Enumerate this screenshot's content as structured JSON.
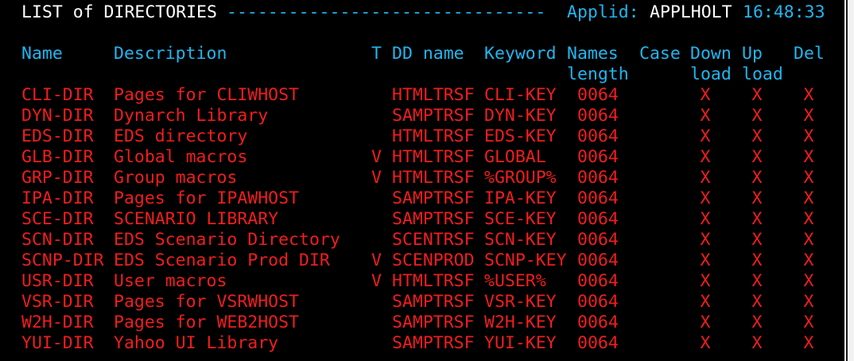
{
  "header": {
    "title": "LIST of DIRECTORIES",
    "dashes": "-------------------------------",
    "applid_label": "Applid:",
    "applid_value": "APPLHOLT",
    "time": "16:48:33"
  },
  "columns": {
    "name": "Name",
    "description": "Description",
    "type": "T",
    "dd_name": "DD name",
    "keyword": "Keyword",
    "names_length_1": "Names",
    "names_length_2": "length",
    "case": "Case",
    "download_1": "Down",
    "download_2": "load",
    "upload_1": "Up",
    "upload_2": "load",
    "del": "Del"
  },
  "rows": [
    {
      "name": "CLI-DIR",
      "description": "Pages for CLIWHOST",
      "type": "",
      "dd": "HTMLTRSF",
      "keyword": "CLI-KEY",
      "length": "0064",
      "case": "",
      "down": "X",
      "up": "X",
      "del": "X"
    },
    {
      "name": "DYN-DIR",
      "description": "Dynarch Library",
      "type": "",
      "dd": "SAMPTRSF",
      "keyword": "DYN-KEY",
      "length": "0064",
      "case": "",
      "down": "X",
      "up": "X",
      "del": "X"
    },
    {
      "name": "EDS-DIR",
      "description": "EDS directory",
      "type": "",
      "dd": "HTMLTRSF",
      "keyword": "EDS-KEY",
      "length": "0064",
      "case": "",
      "down": "X",
      "up": "X",
      "del": "X"
    },
    {
      "name": "GLB-DIR",
      "description": "Global macros",
      "type": "V",
      "dd": "HTMLTRSF",
      "keyword": "GLOBAL",
      "length": "0064",
      "case": "",
      "down": "X",
      "up": "X",
      "del": "X"
    },
    {
      "name": "GRP-DIR",
      "description": "Group macros",
      "type": "V",
      "dd": "HTMLTRSF",
      "keyword": "%GROUP%",
      "length": "0064",
      "case": "",
      "down": "X",
      "up": "X",
      "del": "X"
    },
    {
      "name": "IPA-DIR",
      "description": "Pages for IPAWHOST",
      "type": "",
      "dd": "SAMPTRSF",
      "keyword": "IPA-KEY",
      "length": "0064",
      "case": "",
      "down": "X",
      "up": "X",
      "del": "X"
    },
    {
      "name": "SCE-DIR",
      "description": "SCENARIO LIBRARY",
      "type": "",
      "dd": "SAMPTRSF",
      "keyword": "SCE-KEY",
      "length": "0064",
      "case": "",
      "down": "X",
      "up": "X",
      "del": "X"
    },
    {
      "name": "SCN-DIR",
      "description": "EDS Scenario Directory",
      "type": "",
      "dd": "SCENTRSF",
      "keyword": "SCN-KEY",
      "length": "0064",
      "case": "",
      "down": "X",
      "up": "X",
      "del": "X"
    },
    {
      "name": "SCNP-DIR",
      "description": "EDS Scenario Prod DIR",
      "type": "V",
      "dd": "SCENPROD",
      "keyword": "SCNP-KEY",
      "length": "0064",
      "case": "",
      "down": "X",
      "up": "X",
      "del": "X"
    },
    {
      "name": "USR-DIR",
      "description": "User macros",
      "type": "V",
      "dd": "HTMLTRSF",
      "keyword": "%USER%",
      "length": "0064",
      "case": "",
      "down": "X",
      "up": "X",
      "del": "X"
    },
    {
      "name": "VSR-DIR",
      "description": "Pages for VSRWHOST",
      "type": "",
      "dd": "SAMPTRSF",
      "keyword": "VSR-KEY",
      "length": "0064",
      "case": "",
      "down": "X",
      "up": "X",
      "del": "X"
    },
    {
      "name": "W2H-DIR",
      "description": "Pages for WEB2HOST",
      "type": "",
      "dd": "SAMPTRSF",
      "keyword": "W2H-KEY",
      "length": "0064",
      "case": "",
      "down": "X",
      "up": "X",
      "del": "X"
    },
    {
      "name": "YUI-DIR",
      "description": "Yahoo UI Library",
      "type": "",
      "dd": "SAMPTRSF",
      "keyword": "YUI-KEY",
      "length": "0064",
      "case": "",
      "down": "X",
      "up": "X",
      "del": "X"
    }
  ]
}
